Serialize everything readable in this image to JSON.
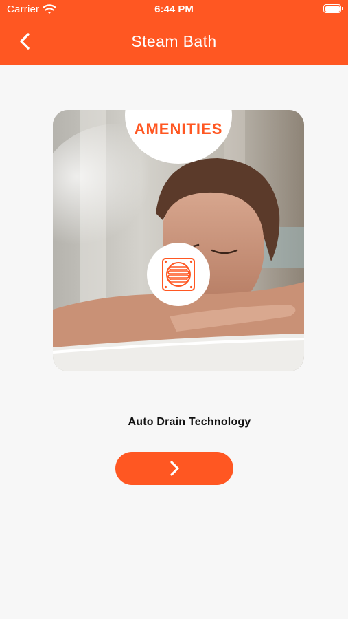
{
  "status_bar": {
    "carrier": "Carrier",
    "time": "6:44 PM",
    "wifi_icon": "wifi-icon",
    "battery_icon": "battery-icon"
  },
  "header": {
    "title": "Steam Bath",
    "back_icon": "chevron-left-icon"
  },
  "card": {
    "badge_label": "AMENITIES",
    "photo": "woman-relaxing-in-steam-bath",
    "feature_icon": "drain-grate-icon"
  },
  "feature": {
    "name": "Auto Drain Technology"
  },
  "next_button": {
    "icon": "chevron-right-icon"
  },
  "colors": {
    "accent": "#ff5722",
    "background": "#f7f7f7",
    "text": "#111111"
  }
}
